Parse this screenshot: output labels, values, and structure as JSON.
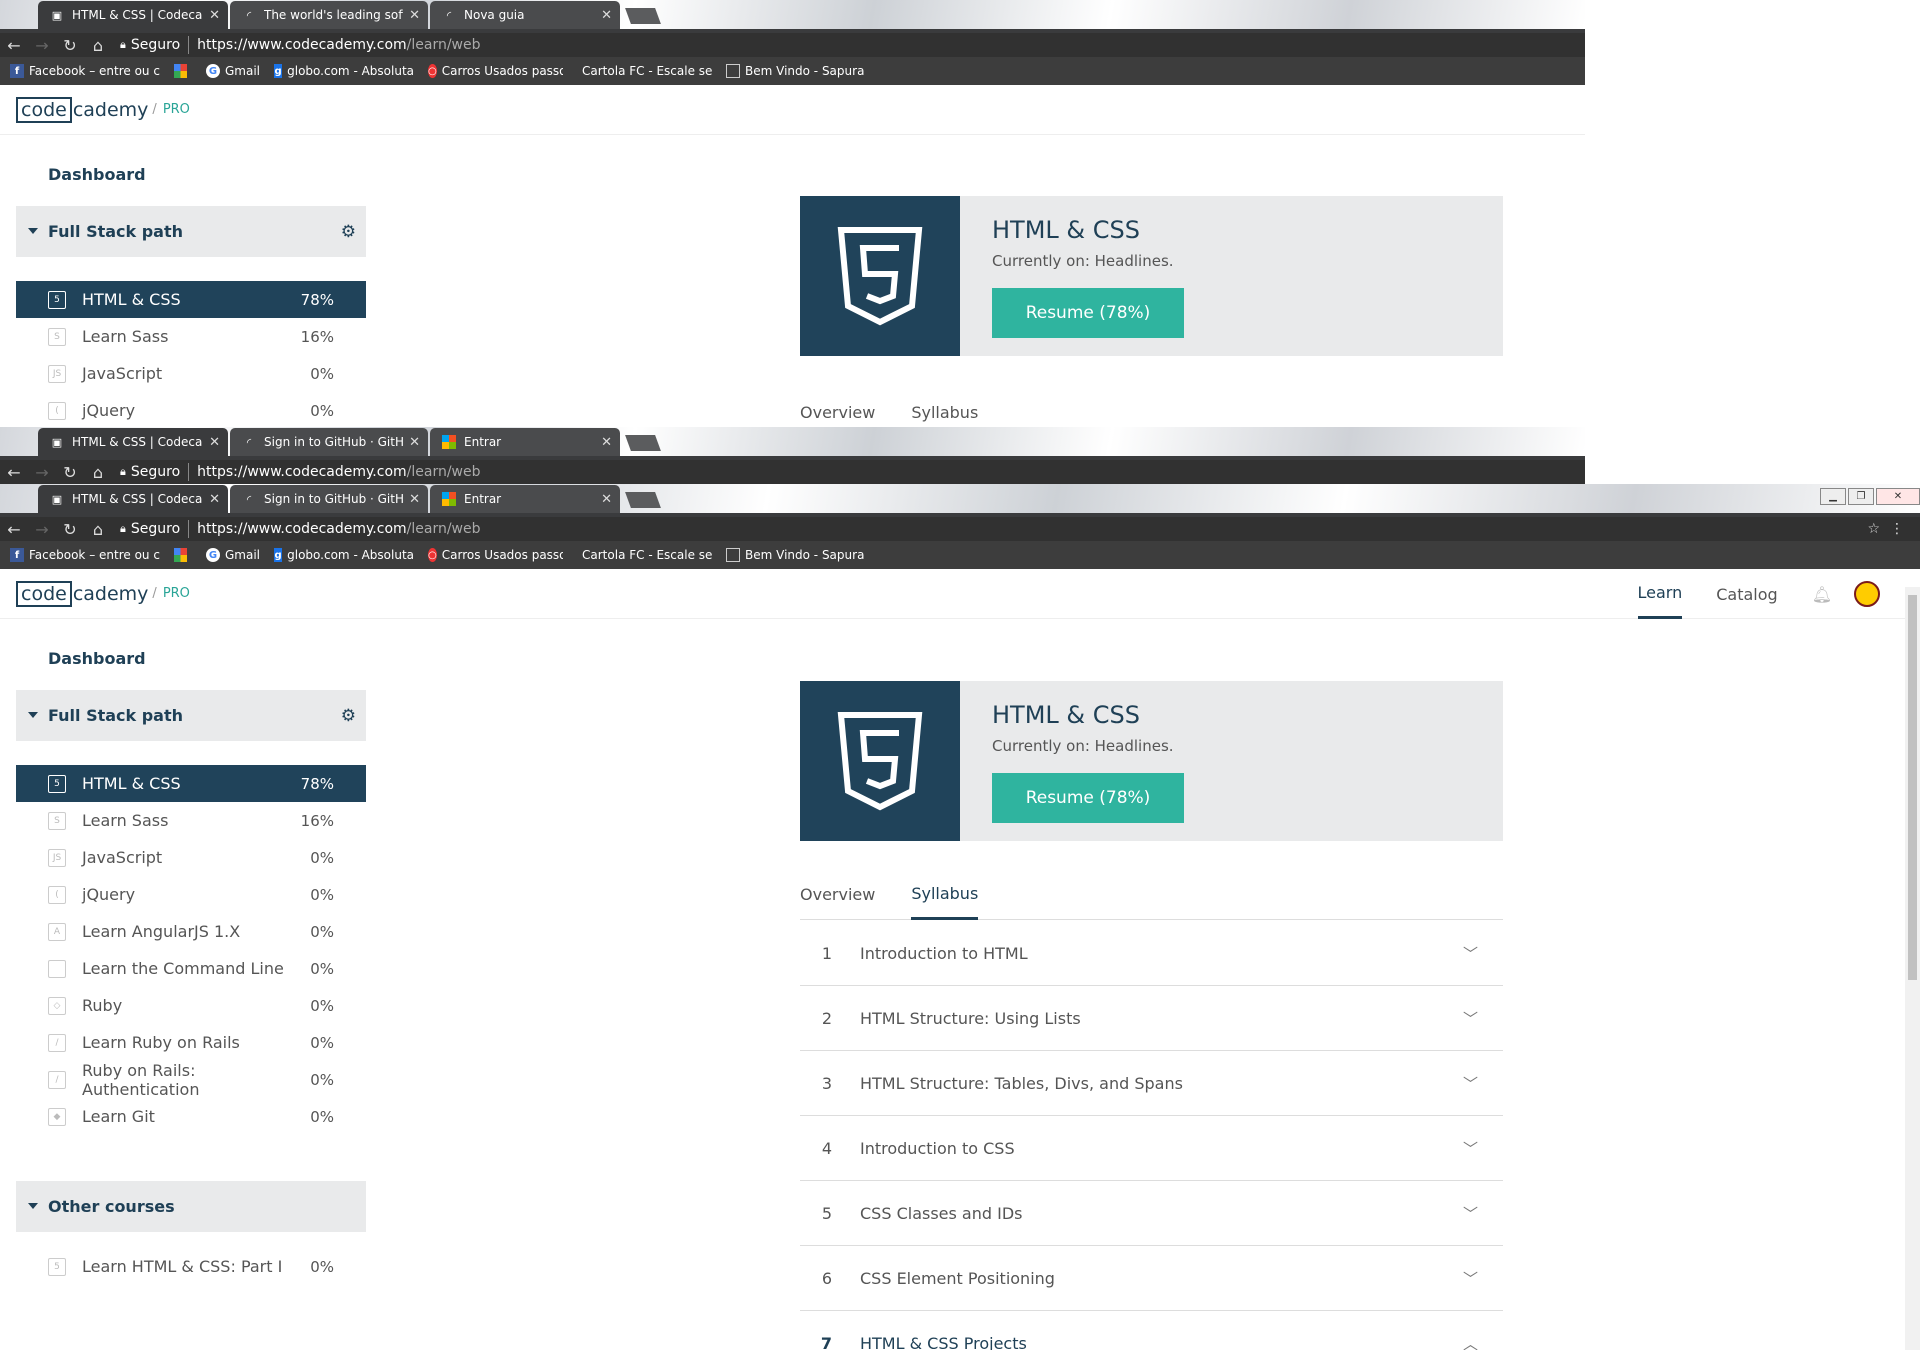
{
  "colors": {
    "navy": "#20435a",
    "teal": "#2fb49f",
    "panel": "#e9eaeb"
  },
  "win1": {
    "tabs": [
      {
        "title": "HTML & CSS | Codecade",
        "icon": "codecademy-icon"
      },
      {
        "title": "The world's leading softw",
        "icon": "spinner-icon"
      },
      {
        "title": "Nova guia",
        "icon": "spinner-icon"
      }
    ],
    "secure": "Seguro",
    "url_host": "https://www.codecademy.com",
    "url_path": "/learn/web",
    "bookmarks": [
      "Facebook – entre ou c",
      "",
      "Gmail",
      "globo.com - Absoluta",
      "Carros Usados passo",
      "Cartola FC - Escale se",
      "Bem Vindo - Sapura"
    ],
    "logo": {
      "code": "code",
      "cad": "cademy",
      "slash": "/",
      "pro": "PRO"
    },
    "dashboard": "Dashboard",
    "section": "Full Stack path",
    "courses": [
      {
        "name": "HTML & CSS",
        "pct": "78%"
      },
      {
        "name": "Learn Sass",
        "pct": "16%"
      },
      {
        "name": "JavaScript",
        "pct": "0%"
      },
      {
        "name": "jQuery",
        "pct": "0%"
      }
    ],
    "hero": {
      "title": "HTML & CSS",
      "sub": "Currently on: Headlines.",
      "resume": "Resume (78%)"
    },
    "tabs2": [
      "Overview",
      "Syllabus"
    ]
  },
  "win2": {
    "tabs": [
      {
        "title": "HTML & CSS | Codecade",
        "icon": "codecademy-icon"
      },
      {
        "title": "Sign in to GitHub · GitHu",
        "icon": "spinner-icon"
      },
      {
        "title": "Entrar",
        "icon": "windows-icon"
      }
    ],
    "secure": "Seguro",
    "url_host": "https://www.codecademy.com",
    "url_path": "/learn/web"
  },
  "win3": {
    "tabs": [
      {
        "title": "HTML & CSS | Codecade",
        "icon": "codecademy-icon"
      },
      {
        "title": "Sign in to GitHub · GitHu",
        "icon": "spinner-icon"
      },
      {
        "title": "Entrar",
        "icon": "windows-icon"
      }
    ],
    "secure": "Seguro",
    "url_host": "https://www.codecademy.com",
    "url_path": "/learn/web",
    "bookmarks": [
      "Facebook – entre ou c",
      "",
      "Gmail",
      "globo.com - Absoluta",
      "Carros Usados passo",
      "Cartola FC - Escale se",
      "Bem Vindo - Sapura"
    ],
    "logo": {
      "code": "code",
      "cad": "cademy",
      "slash": "/",
      "pro": "PRO"
    },
    "nav": {
      "learn": "Learn",
      "catalog": "Catalog"
    },
    "dashboard": "Dashboard",
    "section": "Full Stack path",
    "courses": [
      {
        "name": "HTML & CSS",
        "pct": "78%",
        "icon": "html5-icon"
      },
      {
        "name": "Learn Sass",
        "pct": "16%",
        "icon": "sass-icon"
      },
      {
        "name": "JavaScript",
        "pct": "0%",
        "icon": "js-icon"
      },
      {
        "name": "jQuery",
        "pct": "0%",
        "icon": "jquery-icon"
      },
      {
        "name": "Learn AngularJS 1.X",
        "pct": "0%",
        "icon": "angular-icon"
      },
      {
        "name": "Learn the Command Line",
        "pct": "0%",
        "icon": "terminal-icon"
      },
      {
        "name": "Ruby",
        "pct": "0%",
        "icon": "ruby-icon"
      },
      {
        "name": "Learn Ruby on Rails",
        "pct": "0%",
        "icon": "rails-icon"
      },
      {
        "name": "Ruby on Rails: Authentication",
        "pct": "0%",
        "icon": "rails-icon"
      },
      {
        "name": "Learn Git",
        "pct": "0%",
        "icon": "git-icon"
      }
    ],
    "section2": "Other courses",
    "other": [
      {
        "name": "Learn HTML & CSS: Part I",
        "pct": "0%",
        "icon": "html5-icon"
      }
    ],
    "hero": {
      "title": "HTML & CSS",
      "sub": "Currently on: Headlines.",
      "resume": "Resume (78%)"
    },
    "tabs2": [
      "Overview",
      "Syllabus"
    ],
    "syllabus": [
      {
        "num": "1",
        "title": "Introduction to HTML"
      },
      {
        "num": "2",
        "title": "HTML Structure: Using Lists"
      },
      {
        "num": "3",
        "title": "HTML Structure: Tables, Divs, and Spans"
      },
      {
        "num": "4",
        "title": "Introduction to CSS"
      },
      {
        "num": "5",
        "title": "CSS Classes and IDs"
      },
      {
        "num": "6",
        "title": "CSS Element Positioning"
      },
      {
        "num": "7",
        "title": "HTML & CSS Projects"
      }
    ]
  }
}
